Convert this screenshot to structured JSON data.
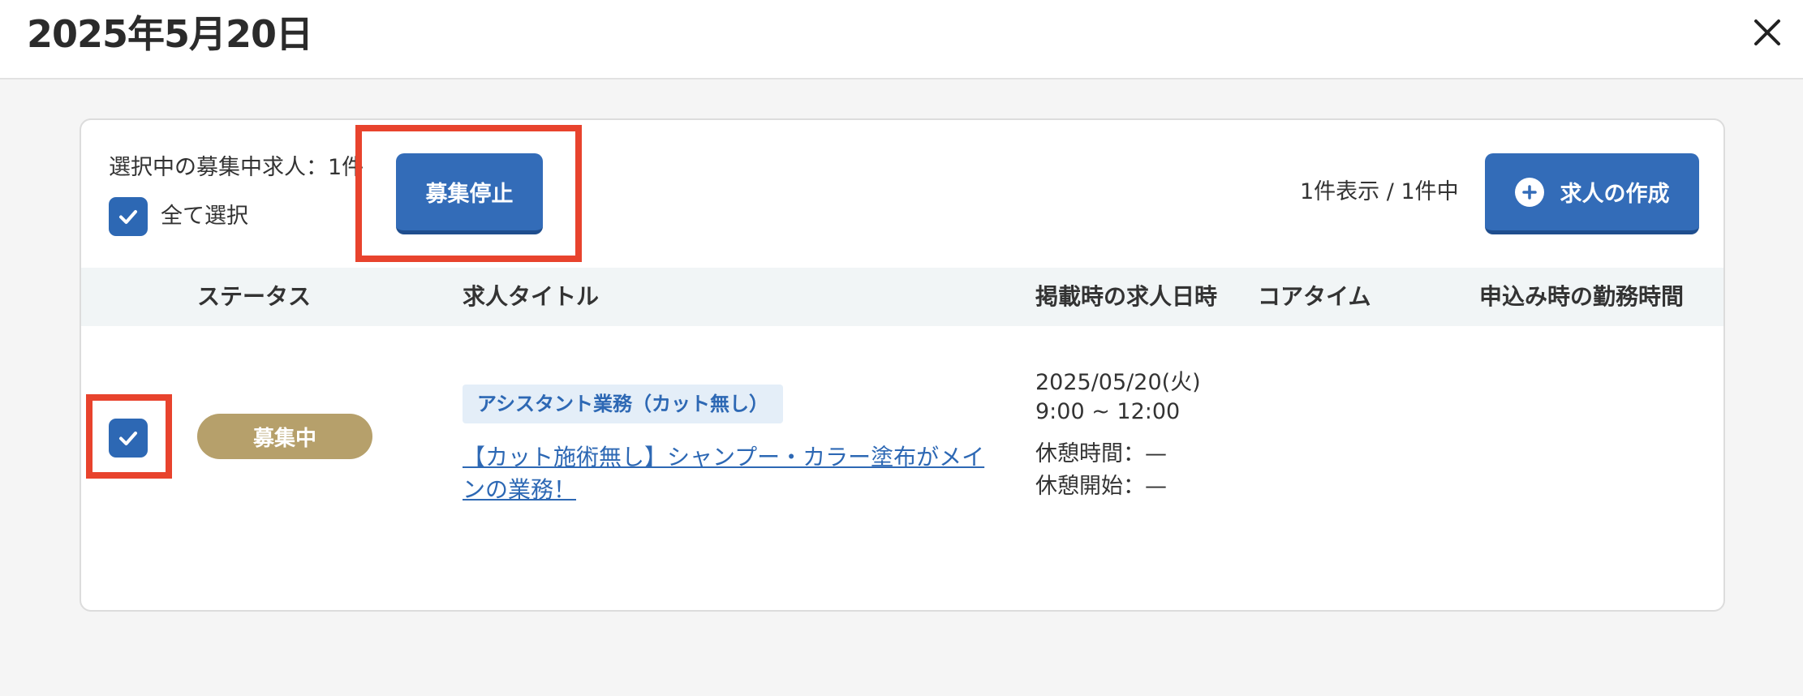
{
  "header": {
    "title": "2025年5月20日"
  },
  "toolbar": {
    "selected_count_label": "選択中の募集中求人：1件",
    "select_all_label": "全て選択",
    "select_all_checked": true,
    "stop_button_label": "募集停止",
    "count_display": "1件表示 / 1件中",
    "create_button_label": "求人の作成"
  },
  "table": {
    "columns": [
      "ステータス",
      "求人タイトル",
      "掲載時の求人日時",
      "コアタイム",
      "申込み時の勤務時間"
    ],
    "rows": [
      {
        "checked": true,
        "status": "募集中",
        "category": "アシスタント業務（カット無し）",
        "title": "【カット施術無し】シャンプー・カラー塗布がメインの業務！",
        "date": "2025/05/20(火)",
        "time": "9:00 ~ 12:00",
        "break_time": "休憩時間：—",
        "break_start": "休憩開始：—",
        "core_time": "",
        "work_hours": ""
      }
    ]
  },
  "colors": {
    "primary": "#336cb8",
    "status_badge": "#b6a06b",
    "highlight": "#e8432d"
  },
  "icons": {
    "close": "close-icon",
    "check": "checkmark-icon",
    "plus": "plus-icon"
  }
}
